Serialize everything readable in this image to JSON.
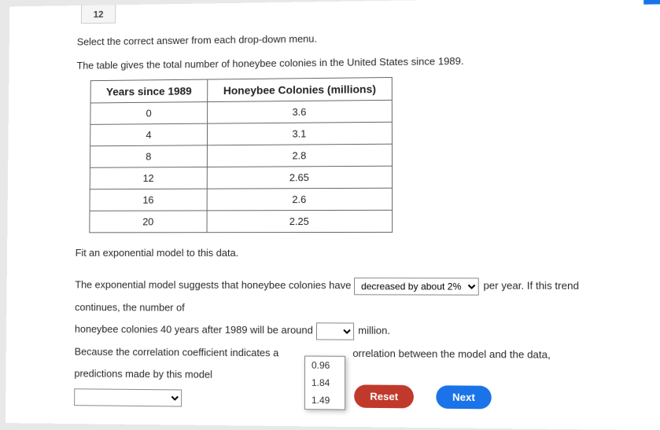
{
  "question_number": "12",
  "instruction": "Select the correct answer from each drop-down menu.",
  "intro": "The table gives the total number of honeybee colonies in the United States since 1989.",
  "table": {
    "head_years": "Years since 1989",
    "head_colonies": "Honeybee Colonies (millions)",
    "rows": [
      {
        "years": "0",
        "colonies": "3.6"
      },
      {
        "years": "4",
        "colonies": "3.1"
      },
      {
        "years": "8",
        "colonies": "2.8"
      },
      {
        "years": "12",
        "colonies": "2.65"
      },
      {
        "years": "16",
        "colonies": "2.6"
      },
      {
        "years": "20",
        "colonies": "2.25"
      }
    ]
  },
  "fit_line": "Fit an exponential model to this data.",
  "para": {
    "p1a": "The exponential model suggests that honeybee colonies have",
    "dd1_selected": "decreased by about 2%",
    "p1b": "per year. If this trend continues, the number of",
    "p2a": "honeybee colonies 40 years after 1989 will be around",
    "p2b": "million.",
    "p3a": "Because the correlation coefficient indicates a",
    "p3b": "orrelation between the model and the data, predictions made by this model"
  },
  "dropdown_open_options": [
    "0.96",
    "1.84",
    "1.49"
  ],
  "buttons": {
    "reset": "Reset",
    "next": "Next"
  }
}
